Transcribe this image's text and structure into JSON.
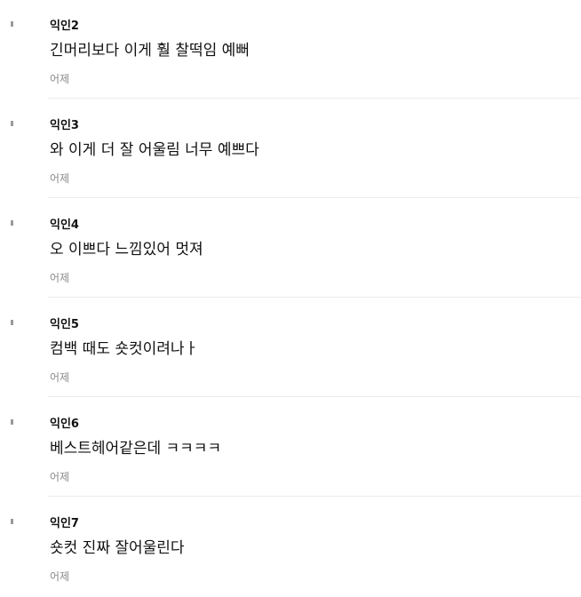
{
  "comments": [
    {
      "author": "익인2",
      "text": "긴머리보다 이게 훨 찰떡임 예뻐",
      "time": "어제",
      "avatar_shape": "stacked-discs",
      "avatar_color": "#1fbf6a"
    },
    {
      "author": "익인3",
      "text": "와 이게 더 잘 어울림 너무 예쁘다",
      "time": "어제",
      "avatar_shape": "tilted-oval",
      "avatar_color": "#1cc9a0"
    },
    {
      "author": "익인4",
      "text": "오 이쁘다 느낌있어 멋져",
      "time": "어제",
      "avatar_shape": "leaf",
      "avatar_color": "#19b86a"
    },
    {
      "author": "익인5",
      "text": "컴백 때도 숏컷이려나ㅏ",
      "time": "어제",
      "avatar_shape": "leaf",
      "avatar_color": "#19b86a"
    },
    {
      "author": "익인6",
      "text": "베스트헤어같은데 ㅋㅋㅋㅋ",
      "time": "어제",
      "avatar_shape": "leaf",
      "avatar_color": "#19b86a"
    },
    {
      "author": "익인7",
      "text": "숏컷 진짜 잘어울린다",
      "time": "어제",
      "avatar_shape": "flat-disc",
      "avatar_color": "#1cc9a0"
    }
  ]
}
